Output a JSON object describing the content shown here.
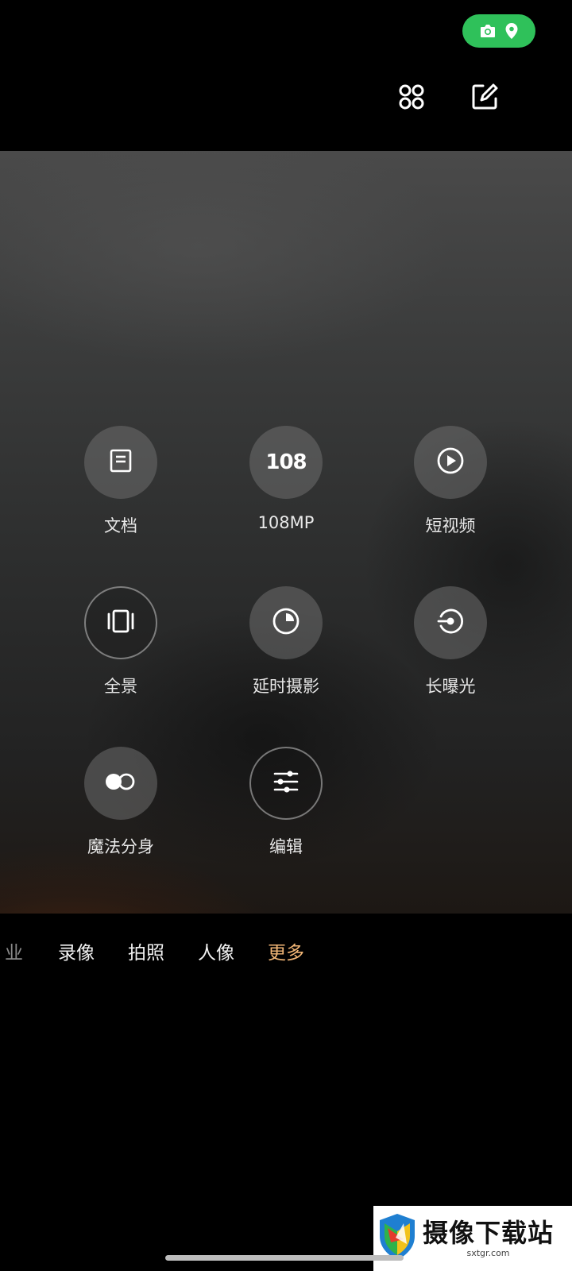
{
  "status_indicator": {
    "icons": [
      "camera-icon",
      "location-pin-icon"
    ],
    "color": "#2fc15a"
  },
  "toolbar": {
    "icons": [
      "grid-dots-icon",
      "edit-icon"
    ]
  },
  "modes": [
    {
      "label": "文档",
      "icon": "document-icon"
    },
    {
      "label": "108MP",
      "icon_text": "108"
    },
    {
      "label": "短视频",
      "icon": "play-icon"
    },
    {
      "label": "全景",
      "icon": "panorama-icon"
    },
    {
      "label": "延时摄影",
      "icon": "timelapse-icon"
    },
    {
      "label": "长曝光",
      "icon": "long-exposure-icon"
    },
    {
      "label": "魔法分身",
      "icon": "clone-icon"
    },
    {
      "label": "编辑",
      "icon": "sliders-icon"
    }
  ],
  "tabs": [
    {
      "label": "业",
      "state": "partial"
    },
    {
      "label": "录像"
    },
    {
      "label": "拍照"
    },
    {
      "label": "人像"
    },
    {
      "label": "更多",
      "state": "active"
    }
  ],
  "colors": {
    "active_tab": "#f2b676"
  },
  "watermark": {
    "title": "摄像下载站",
    "url": "sxtgr.com"
  }
}
